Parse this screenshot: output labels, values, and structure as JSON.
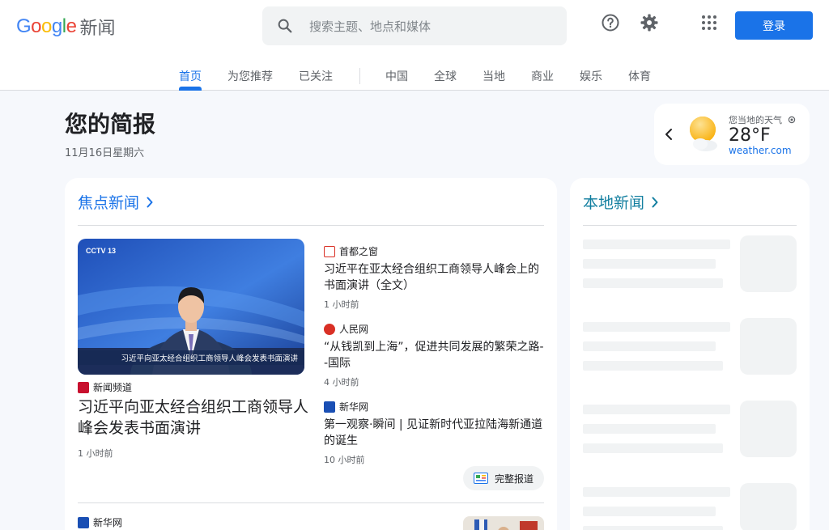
{
  "header": {
    "logo_letters": [
      "G",
      "o",
      "o",
      "g",
      "l",
      "e"
    ],
    "logo_suffix": "新闻",
    "search_placeholder": "搜索主题、地点和媒体",
    "login_label": "登录"
  },
  "tabs": [
    {
      "label": "首页",
      "active": true
    },
    {
      "label": "为您推荐"
    },
    {
      "label": "已关注"
    },
    {
      "label": "中国"
    },
    {
      "label": "全球"
    },
    {
      "label": "当地"
    },
    {
      "label": "商业"
    },
    {
      "label": "娱乐"
    },
    {
      "label": "体育"
    }
  ],
  "briefing": {
    "title": "您的简报",
    "date": "11月16日星期六"
  },
  "weather": {
    "label": "您当地的天气",
    "temp": "28°F",
    "source": "weather.com"
  },
  "headlines": {
    "title": "焦点新闻",
    "hero": {
      "image_caption": "习近平向亚太经合组织工商领导人峰会发表书面演讲",
      "channel_badge": "CCTV 13",
      "source": "新闻频道",
      "title": "习近平向亚太经合组织工商领导人峰会发表书面演讲",
      "time": "1 小时前"
    },
    "related": [
      {
        "source": "首都之窗",
        "title": "习近平在亚太经合组织工商领导人峰会上的书面演讲（全文）",
        "time": "1 小时前"
      },
      {
        "source": "人民网",
        "title": "“从钱凯到上海”，促进共同发展的繁荣之路--国际",
        "time": "4 小时前"
      },
      {
        "source": "新华网",
        "title": "第一观察·瞬间 | 见证新时代亚拉陆海新通道的诞生",
        "time": "10 小时前"
      }
    ],
    "full_coverage_label": "完整报道",
    "next_story": {
      "source": "新华网"
    }
  },
  "local": {
    "title": "本地新闻"
  },
  "colors": {
    "accent": "#1a73e8",
    "local_title": "#137fa0"
  }
}
